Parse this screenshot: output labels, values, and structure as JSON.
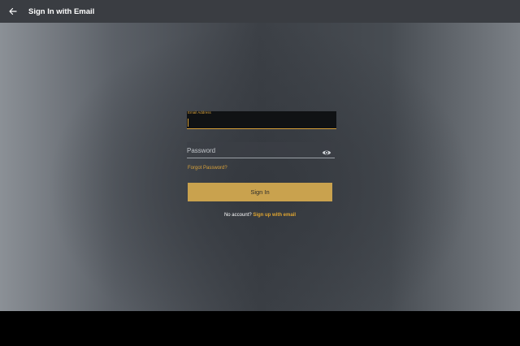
{
  "appbar": {
    "title": "Sign In with Email"
  },
  "form": {
    "email_label": "Email Address",
    "password_placeholder": "Password",
    "forgot_link": "Forgot Password?",
    "signin_label": "Sign In",
    "no_account_text": "No account?",
    "signup_link": "Sign up with email"
  },
  "icons": {
    "back": "arrow-back-icon",
    "password_toggle": "eye-icon"
  },
  "colors": {
    "accent": "#d8a13a",
    "button": "#c9a24e",
    "appbar": "#3a3d42"
  }
}
